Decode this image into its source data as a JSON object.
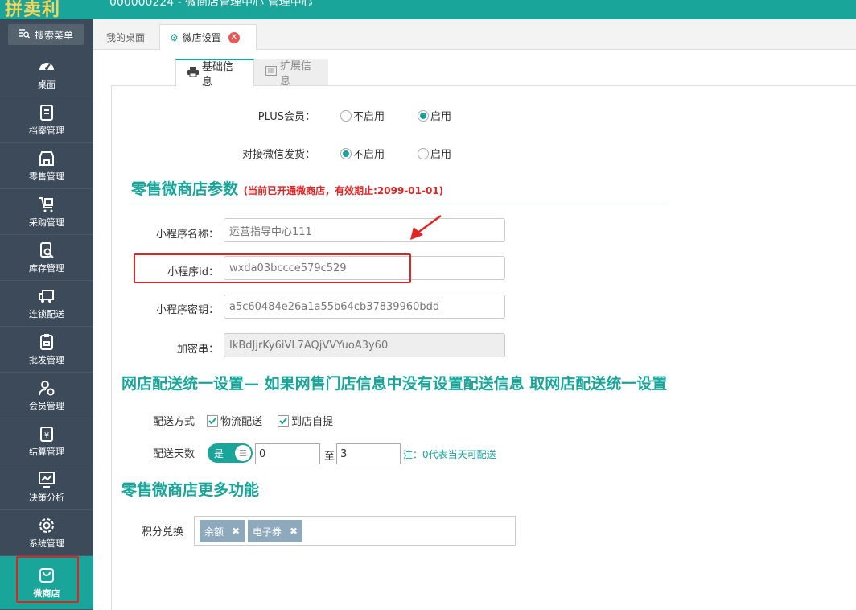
{
  "app": {
    "logo_text": "拼卖利",
    "title": "000000224 - 微商店管理中心 管理中心"
  },
  "sidebar": {
    "search_label": "搜索菜单",
    "items": [
      {
        "label": "桌面",
        "icon": "dashboard-icon"
      },
      {
        "label": "档案管理",
        "icon": "archive-icon"
      },
      {
        "label": "零售管理",
        "icon": "store-icon"
      },
      {
        "label": "采购管理",
        "icon": "cart-icon"
      },
      {
        "label": "库存管理",
        "icon": "inventory-icon"
      },
      {
        "label": "连锁配送",
        "icon": "truck-icon"
      },
      {
        "label": "批发管理",
        "icon": "wholesale-icon"
      },
      {
        "label": "会员管理",
        "icon": "member-icon"
      },
      {
        "label": "结算管理",
        "icon": "settlement-icon"
      },
      {
        "label": "决策分析",
        "icon": "analysis-icon"
      },
      {
        "label": "系统管理",
        "icon": "gear-icon"
      },
      {
        "label": "微商店",
        "icon": "shop-bag-icon"
      }
    ]
  },
  "tabs": {
    "desktop": "我的桌面",
    "shop_settings": "微店设置"
  },
  "subtabs": {
    "basic": "基础信息",
    "extended": "扩展信息"
  },
  "settings": {
    "plus_label": "PLUS会员：",
    "plus_off": "不启用",
    "plus_on": "启用",
    "wechat_ship_label": "对接微信发货：",
    "wechat_off": "不启用",
    "wechat_on": "启用"
  },
  "retail_params": {
    "title": "零售微商店参数",
    "note": "(当前已开通微商店，有效期止:2099-01-01)",
    "miniapp_name_label": "小程序名称：",
    "miniapp_name_value": "运营指导中心111",
    "miniapp_id_label": "小程序id：",
    "miniapp_id_value": "wxda03bccce579c529",
    "miniapp_secret_label": "小程序密钥：",
    "miniapp_secret_value": "a5c60484e26a1a55b64cb37839960bdd",
    "encrypt_label": "加密串：",
    "encrypt_value": "IkBdJjrKy6iVL7AQjVVYuoA3y60"
  },
  "delivery": {
    "title": "网店配送统一设置— 如果网售门店信息中没有设置配送信息 取网店配送统一设置",
    "method_label": "配送方式",
    "method_logistics": "物流配送",
    "method_pickup": "到店自提",
    "days_label": "配送天数",
    "toggle_label": "是",
    "days_from": "0",
    "to_label": "至",
    "days_to": "3",
    "note": "注：0代表当天可配送"
  },
  "more": {
    "title": "零售微商店更多功能",
    "points_label": "积分兑换",
    "tags": [
      "余额",
      "电子券"
    ]
  },
  "colors": {
    "accent": "#1aa59a",
    "sidebar_bg": "#3c4a5a",
    "highlight": "#e02424"
  }
}
